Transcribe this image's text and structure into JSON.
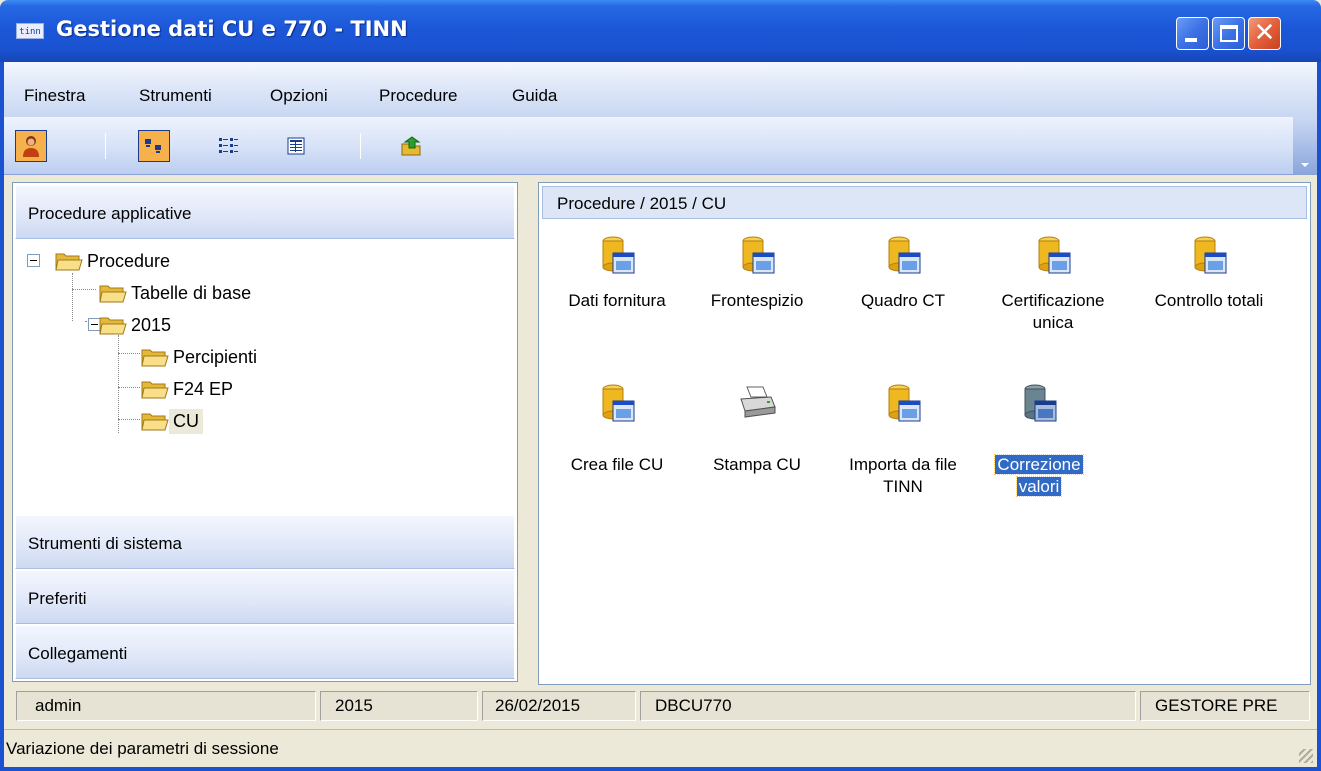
{
  "window": {
    "title": "Gestione dati CU e 770 - TINN",
    "app_icon_text": "tinn"
  },
  "menu": [
    {
      "label": "Finestra"
    },
    {
      "label": "Strumenti"
    },
    {
      "label": "Opzioni"
    },
    {
      "label": "Procedure"
    },
    {
      "label": "Guida"
    }
  ],
  "toolbar": {
    "icons": [
      "user-icon",
      "large-icons-view-icon",
      "list-view-icon",
      "details-view-icon",
      "export-icon"
    ],
    "active": [
      "user-icon",
      "large-icons-view-icon"
    ]
  },
  "left_panel": {
    "sections": [
      {
        "label": "Procedure applicative"
      },
      {
        "label": "Strumenti di sistema"
      },
      {
        "label": "Preferiti"
      },
      {
        "label": "Collegamenti"
      }
    ],
    "tree": [
      {
        "label": "Procedure",
        "expanded": true
      },
      {
        "label": "Tabelle di base"
      },
      {
        "label": "2015",
        "expanded": true
      },
      {
        "label": "Percipienti"
      },
      {
        "label": "F24 EP"
      },
      {
        "label": "CU",
        "selected": true
      }
    ]
  },
  "right_panel": {
    "breadcrumb": "Procedure / 2015 / CU",
    "items": [
      {
        "label_1": "Dati fornitura",
        "label_2": "",
        "icon": "database-form-icon"
      },
      {
        "label_1": "Frontespizio",
        "label_2": "",
        "icon": "database-form-icon"
      },
      {
        "label_1": "Quadro CT",
        "label_2": "",
        "icon": "database-form-icon"
      },
      {
        "label_1": "Certificazione",
        "label_2": "unica",
        "icon": "database-form-icon"
      },
      {
        "label_1": "Controllo totali",
        "label_2": "",
        "icon": "database-form-icon"
      },
      {
        "label_1": "Crea file CU",
        "label_2": "",
        "icon": "database-form-icon"
      },
      {
        "label_1": "Stampa CU",
        "label_2": "",
        "icon": "printer-icon"
      },
      {
        "label_1": "Importa da file",
        "label_2": "TINN",
        "icon": "database-form-icon"
      },
      {
        "label_1": "Correzione",
        "label_2": "valori",
        "icon": "database-form-icon",
        "selected": true
      }
    ]
  },
  "status": {
    "user": "admin",
    "year": "2015",
    "date": "26/02/2015",
    "database": "DBCU770",
    "role": "GESTORE PRE",
    "message": "Variazione dei parametri di sessione"
  },
  "colors": {
    "titlebar": "#1a52d0",
    "selection": "#316ac5",
    "active_tool": "#f6b04c"
  }
}
